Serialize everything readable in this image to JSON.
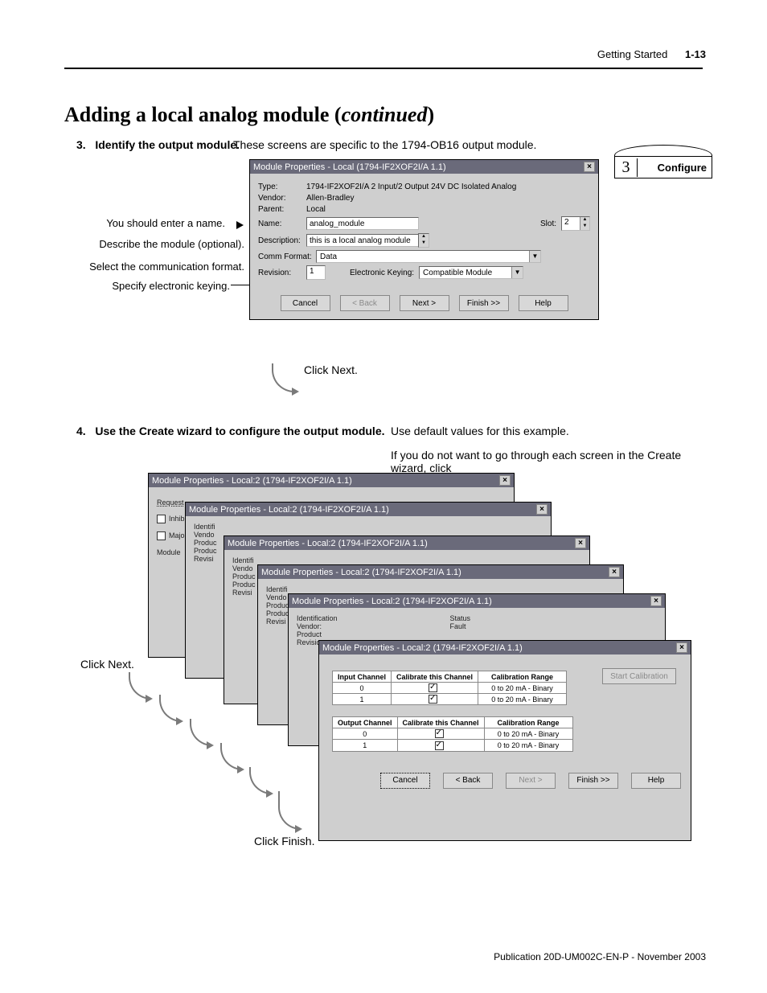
{
  "header": {
    "section": "Getting Started",
    "page": "1-13"
  },
  "title": {
    "main": "Adding a local analog module (",
    "cont": "continued",
    "close": ")"
  },
  "step3": {
    "num_label": "3.",
    "heading": "Identify the output module.",
    "desc": "These screens are specific to the 1794-OB16 output module.",
    "callouts": {
      "name": "You should enter a name.",
      "desc": "Describe the module (optional).",
      "comm": "Select the communication format.",
      "key": "Specify electronic keying."
    },
    "click_next": "Click Next."
  },
  "configure_tab": {
    "num": "3",
    "label": "Configure"
  },
  "dialog1": {
    "title": "Module Properties - Local (1794-IF2XOF2I/A 1.1)",
    "rows": {
      "type_lbl": "Type:",
      "type_val": "1794-IF2XOF2I/A 2 Input/2 Output 24V DC Isolated Analog",
      "vendor_lbl": "Vendor:",
      "vendor_val": "Allen-Bradley",
      "parent_lbl": "Parent:",
      "parent_val": "Local",
      "name_lbl": "Name:",
      "name_val": "analog_module",
      "slot_lbl": "Slot:",
      "slot_val": "2",
      "descr_lbl": "Description:",
      "descr_val": "this is a local analog module",
      "comm_lbl": "Comm Format:",
      "comm_val": "Data",
      "rev_lbl": "Revision:",
      "rev_val": "1",
      "ekey_lbl": "Electronic Keying:",
      "ekey_val": "Compatible Module"
    },
    "buttons": {
      "cancel": "Cancel",
      "back": "< Back",
      "next": "Next >",
      "finish": "Finish >>",
      "help": "Help"
    }
  },
  "step4": {
    "num_label": "4.",
    "heading": "Use the Create wizard to configure the output module.",
    "p1": "Use default values for this example.",
    "p2": "If you do not want to go through each screen in the Create wizard, click",
    "click_next": "Click Next.",
    "click_finish": "Click Finish."
  },
  "wizard_common": {
    "title": "Module Properties - Local:2 (1794-IF2XOF2I/A 1.1)"
  },
  "w1": {
    "request_lbl": "Request",
    "inhibit_lbl": "Inhib",
    "major_lbl": "Majo",
    "module_lbl": "Module"
  },
  "w2": {
    "ident": "Identifi",
    "vendor": "Vendo",
    "produc": "Produc",
    "revis": "Revisi"
  },
  "w5": {
    "identification": "Identification",
    "vendor": "Vendor:",
    "product": "Product",
    "revision": "Revision",
    "status": "Status",
    "fault": "Fault"
  },
  "w6": {
    "start_cal": "Start Calibration",
    "input_hdr": {
      "c1": "Input Channel",
      "c2": "Calibrate this Channel",
      "c3": "Calibration Range"
    },
    "output_hdr": {
      "c1": "Output Channel",
      "c2": "Calibrate this Channel",
      "c3": "Calibration Range"
    },
    "rows_in": [
      {
        "ch": "0",
        "cal": true,
        "range": "0 to 20 mA - Binary"
      },
      {
        "ch": "1",
        "cal": true,
        "range": "0 to 20 mA - Binary"
      }
    ],
    "rows_out": [
      {
        "ch": "0",
        "cal": true,
        "range": "0 to 20 mA - Binary"
      },
      {
        "ch": "1",
        "cal": true,
        "range": "0 to 20 mA - Binary"
      }
    ],
    "buttons": {
      "cancel": "Cancel",
      "back": "< Back",
      "next": "Next >",
      "finish": "Finish >>",
      "help": "Help"
    }
  },
  "footer": "Publication 20D-UM002C-EN-P - November 2003"
}
